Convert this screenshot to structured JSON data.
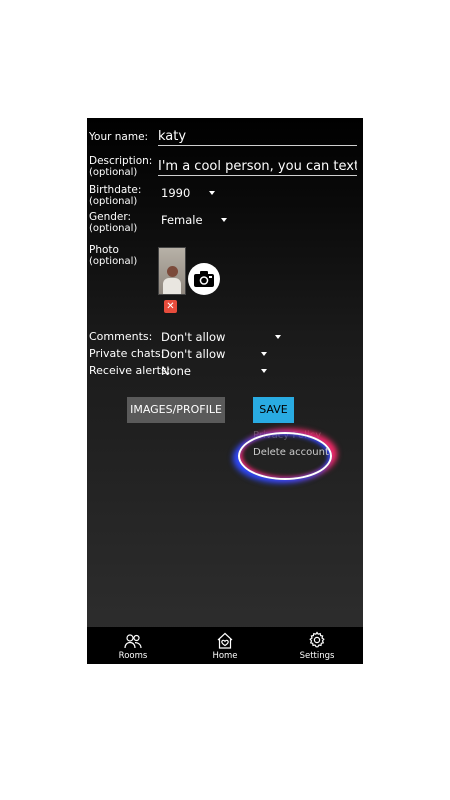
{
  "profile": {
    "name_label": "Your name:",
    "name_value": "katy",
    "description_label": "Description:",
    "description_optional": "(optional)",
    "description_value": "I'm a cool person, you can text me",
    "birthdate_label": "Birthdate:",
    "birthdate_optional": "(optional)",
    "birthdate_value": "1990",
    "gender_label": "Gender:",
    "gender_optional": "(optional)",
    "gender_value": "Female",
    "photo_label": "Photo",
    "photo_optional": "(optional)"
  },
  "settings": {
    "comments_label": "Comments:",
    "comments_value": "Don't allow",
    "private_chats_label": "Private chats:",
    "private_chats_value": "Don't allow",
    "receive_alerts_label": "Receive alerts:",
    "receive_alerts_value": "None"
  },
  "actions": {
    "images_profile_label": "IMAGES/PROFILE",
    "save_label": "SAVE",
    "privacy_label": "Privacy Policy",
    "delete_account_label": "Delete account"
  },
  "tabbar": {
    "items": [
      {
        "label": "Rooms",
        "icon": "rooms-icon"
      },
      {
        "label": "Home",
        "icon": "home-icon"
      },
      {
        "label": "Settings",
        "icon": "gear-icon"
      }
    ]
  },
  "colors": {
    "accent": "#29abe2",
    "secondary_button": "#5a5a5a",
    "delete_photo": "#e74c3c"
  }
}
